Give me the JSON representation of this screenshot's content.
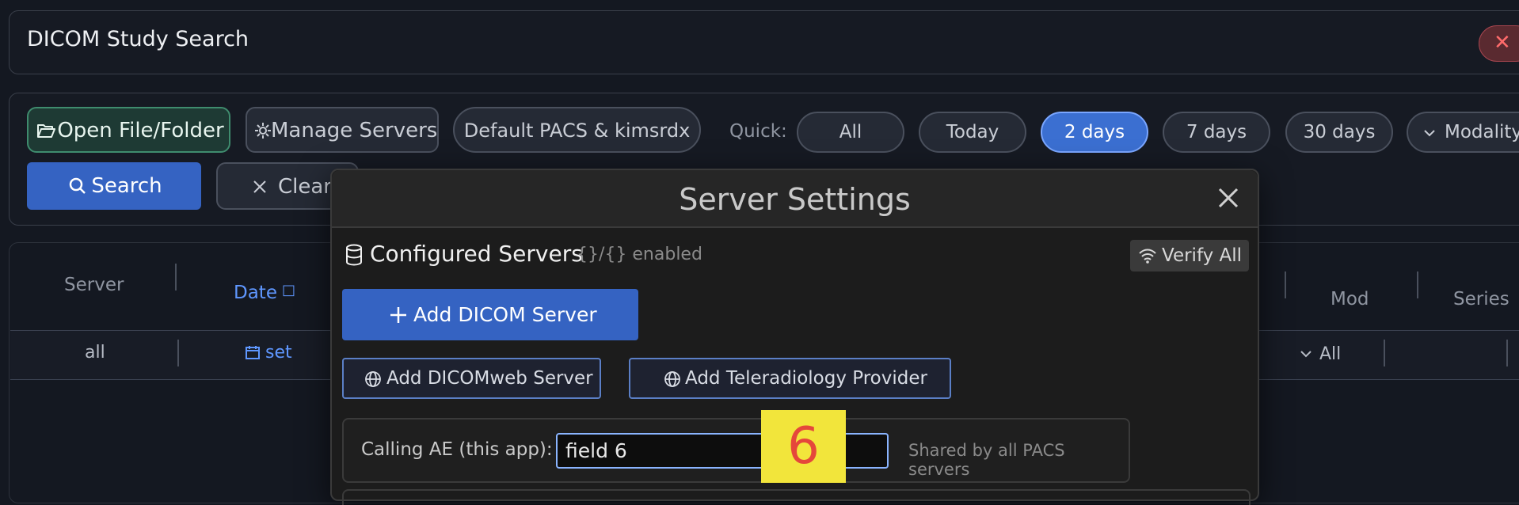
{
  "window": {
    "title": "DICOM Study Search",
    "close_glyph": "✕"
  },
  "toolbar": {
    "open_label": "Open File/Folder",
    "manage_label": "Manage Servers",
    "server_label": "Default PACS & kimsrdx",
    "quick_label": "Quick:",
    "quick": [
      "All",
      "Today",
      "2 days",
      "7 days",
      "30 days"
    ],
    "quick_active": "2 days",
    "modality_label": "Modality",
    "search_label": "Search",
    "clear_label": "Clear"
  },
  "table": {
    "headers": {
      "server": "Server",
      "date": "Date",
      "date_icon": "□",
      "mod": "Mod",
      "series": "Series"
    },
    "filters": {
      "server": "all",
      "date": "set",
      "mod": "All"
    }
  },
  "modal": {
    "title": "Server Settings",
    "section_title": "Configured Servers",
    "section_sub": "{}/{} enabled",
    "verify_label": "Verify All",
    "add_dicom_label": "Add DICOM Server",
    "add_dicomweb_label": "Add DICOMweb Server",
    "add_telerad_label": "Add Teleradiology Provider",
    "ae_label": "Calling AE (this app):",
    "ae_value": "field 6",
    "ae_hint": "Shared by all PACS servers"
  },
  "marker": {
    "label": "6"
  },
  "colors": {
    "accent": "#3563c2",
    "active_pill": "#3b6fd1",
    "marker_bg": "#f2e53b",
    "marker_fg": "#e5473b"
  },
  "icons": [
    "folder-open-icon",
    "gear-icon",
    "chevron-down-icon",
    "search-icon",
    "close-icon",
    "database-icon",
    "wifi-icon",
    "plus-icon",
    "globe-icon",
    "calendar-icon"
  ]
}
